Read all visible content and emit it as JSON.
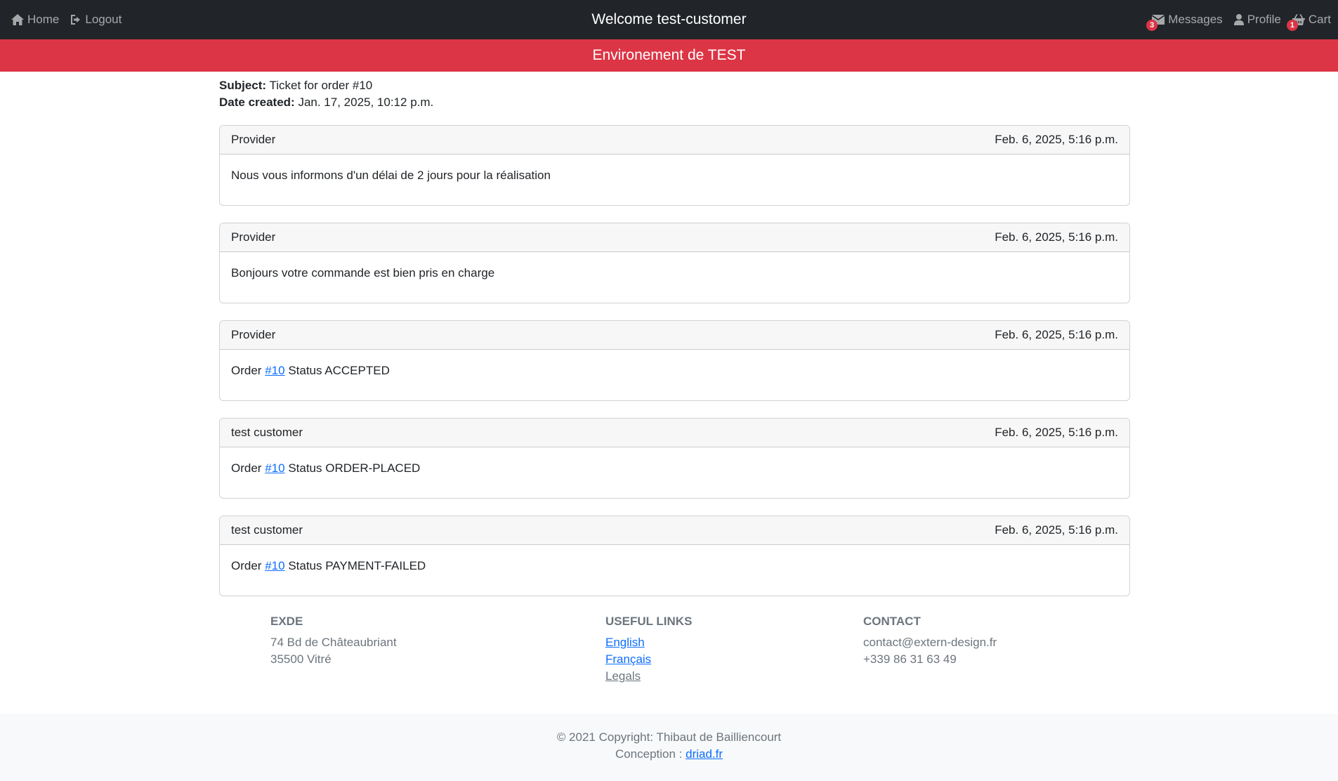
{
  "nav": {
    "home_label": "Home",
    "logout_label": "Logout",
    "title": "Welcome test-customer",
    "messages_label": "Messages",
    "messages_badge": "3",
    "profile_label": "Profile",
    "cart_label": "Cart",
    "cart_badge": "1"
  },
  "banner": {
    "text": "Environement de TEST"
  },
  "ticket": {
    "subject_label": "Subject:",
    "subject_value": "Ticket for order #10",
    "date_label": "Date created:",
    "date_value": "Jan. 17, 2025, 10:12 p.m."
  },
  "messages": [
    {
      "author": "Provider",
      "date": "Feb. 6, 2025, 5:16 p.m.",
      "text": "Nous vous informons d'un délai de 2 jours pour la réalisation"
    },
    {
      "author": "Provider",
      "date": "Feb. 6, 2025, 5:16 p.m.",
      "text": "Bonjours votre commande est bien pris en charge"
    },
    {
      "author": "Provider",
      "date": "Feb. 6, 2025, 5:16 p.m.",
      "prefix": "Order",
      "link": "#10",
      "suffix": "Status ACCEPTED"
    },
    {
      "author": "test customer",
      "date": "Feb. 6, 2025, 5:16 p.m.",
      "prefix": "Order",
      "link": "#10",
      "suffix": "Status ORDER-PLACED"
    },
    {
      "author": "test customer",
      "date": "Feb. 6, 2025, 5:16 p.m.",
      "prefix": "Order",
      "link": "#10",
      "suffix": "Status PAYMENT-FAILED"
    }
  ],
  "footer": {
    "company_heading": "EXDE",
    "address_line1": "74 Bd de Châteaubriant",
    "address_line2": "35500 Vitré",
    "links_heading": "USEFUL LINKS",
    "link_english": "English",
    "link_francais": "Français",
    "link_legals": "Legals",
    "contact_heading": "CONTACT",
    "contact_email": "contact@extern-design.fr",
    "contact_phone": "+339 86 31 63 49",
    "copyright": "© 2021 Copyright: Thibaut de Bailliencourt",
    "conception_label": "Conception :",
    "conception_link": "driad.fr"
  },
  "colors": {
    "navbar": "#212529",
    "banner": "#dc3545",
    "link": "#0d6efd",
    "muted": "#6c757d"
  },
  "icons": [
    "home-icon",
    "logout-icon",
    "envelope-icon",
    "user-icon",
    "basket-icon"
  ]
}
